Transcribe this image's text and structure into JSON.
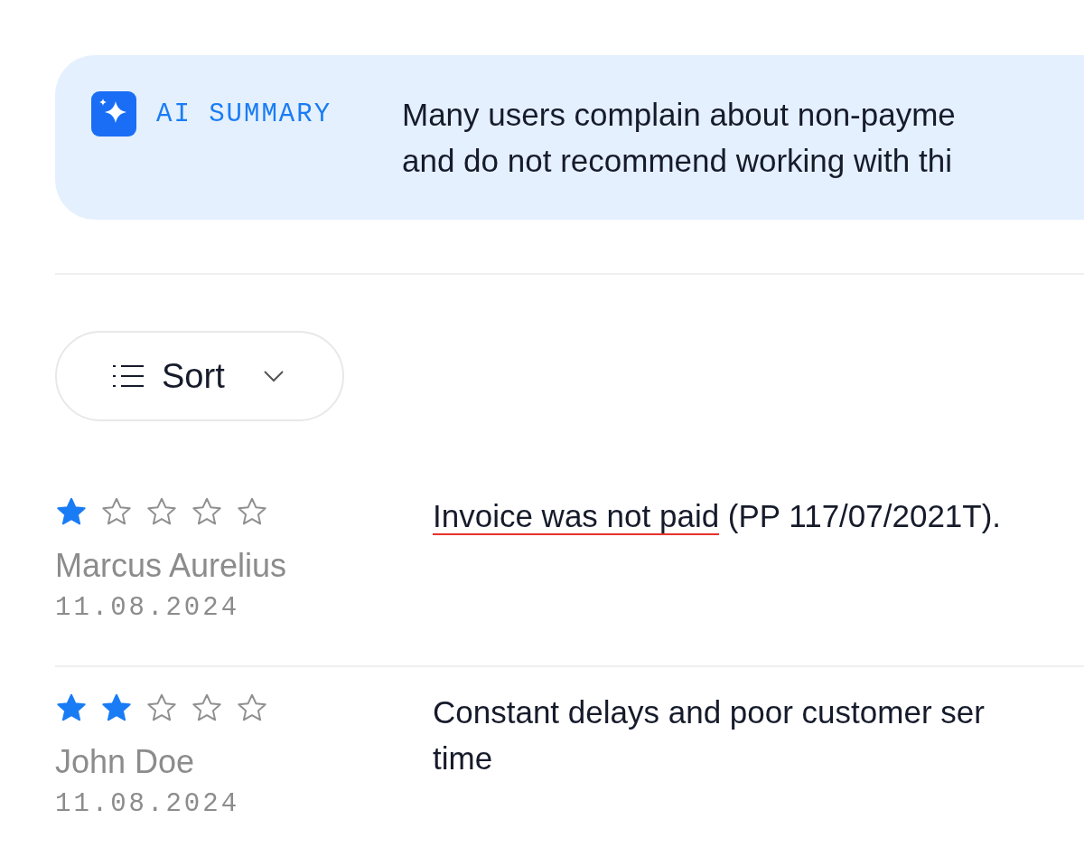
{
  "summary": {
    "label": "AI SUMMARY",
    "lines": [
      "Many users complain about non-payme",
      "and do not recommend working with thi"
    ]
  },
  "sort": {
    "label": "Sort"
  },
  "reviews": [
    {
      "stars": 1,
      "author": "Marcus Aurelius",
      "date": "11.08.2024",
      "lines": [
        [
          {
            "text": "Invoice was not paid",
            "underlined": true
          },
          {
            "text": " (PP 117/07/2021T).",
            "underlined": false
          }
        ]
      ]
    },
    {
      "stars": 2,
      "author": "John Doe",
      "date": "11.08.2024",
      "lines": [
        [
          {
            "text": "Constant delays and poor customer ser",
            "underlined": false
          }
        ],
        [
          {
            "text": "time",
            "underlined": false
          }
        ]
      ]
    }
  ]
}
